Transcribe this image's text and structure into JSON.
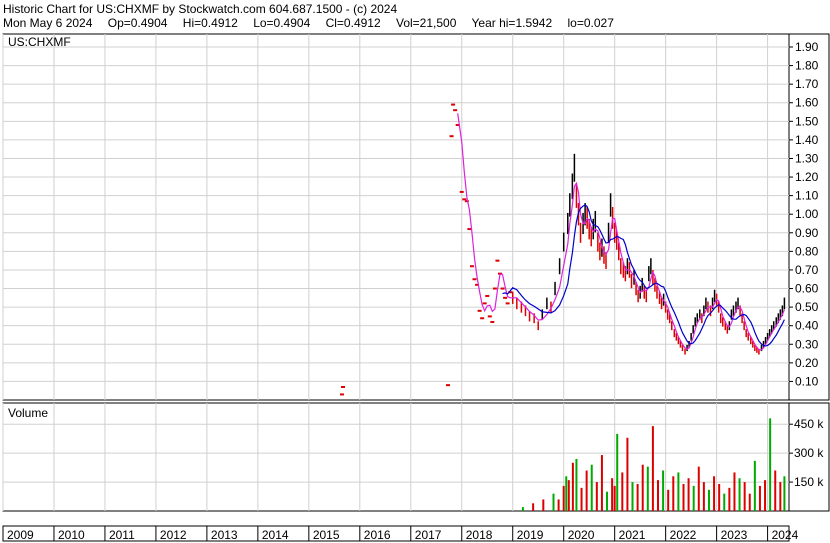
{
  "header": {
    "title": "Historic Chart for US:CHXMF by Stockwatch.com 604.687.1500 - (c) 2024",
    "date": "Mon May  6 2024",
    "open": "Op=0.4904",
    "high": "Hi=0.4912",
    "low": "Lo=0.4904",
    "close": "Cl=0.4912",
    "volume": "Vol=21,500",
    "year_high": "Year hi=1.5942",
    "year_low": "lo=0.027"
  },
  "chart_data": [
    {
      "type": "line",
      "title": "US:CHXMF",
      "price_ticks": [
        "1.90",
        "1.80",
        "1.70",
        "1.60",
        "1.50",
        "1.40",
        "1.30",
        "1.20",
        "1.10",
        "1.00",
        "0.90",
        "0.80",
        "0.70",
        "0.60",
        "0.50",
        "0.40",
        "0.30",
        "0.20",
        "0.10"
      ],
      "ylim": [
        0.0,
        1.97
      ],
      "xlim": [
        2009.0,
        2024.42
      ],
      "grid": true,
      "colors": {
        "bars": "#000000",
        "down": "#dd0000",
        "ma_short": "#dd22dd",
        "ma_long": "#0000cc",
        "grid": "#d0d0d0"
      },
      "series": [
        {
          "values_x": [
            2015.65,
            2015.67,
            2017.73,
            2017.8,
            2017.83,
            2017.87,
            2017.92,
            2018.0,
            2018.05,
            2018.1,
            2018.15,
            2018.2,
            2018.25,
            2018.3,
            2018.35,
            2018.4,
            2018.45,
            2018.5,
            2018.55,
            2018.6,
            2018.65,
            2018.7,
            2018.75,
            2018.8,
            2018.85,
            2018.9,
            2018.95,
            2019.0,
            2019.08,
            2019.17,
            2019.25,
            2019.33,
            2019.42,
            2019.5,
            2019.58,
            2019.67,
            2019.75,
            2019.83,
            2019.92,
            2020.0,
            2020.08,
            2020.12,
            2020.17,
            2020.21,
            2020.25,
            2020.29,
            2020.33,
            2020.38,
            2020.42,
            2020.46,
            2020.5,
            2020.54,
            2020.58,
            2020.62,
            2020.67,
            2020.71,
            2020.75,
            2020.79,
            2020.83,
            2020.88,
            2020.92,
            2020.96,
            2021.0,
            2021.04,
            2021.08,
            2021.12,
            2021.17,
            2021.21,
            2021.25,
            2021.29,
            2021.33,
            2021.38,
            2021.42,
            2021.46,
            2021.5,
            2021.54,
            2021.58,
            2021.62,
            2021.67,
            2021.71,
            2021.75,
            2021.79,
            2021.83,
            2021.88,
            2021.92,
            2021.96,
            2022.0,
            2022.04,
            2022.08,
            2022.12,
            2022.17,
            2022.21,
            2022.25,
            2022.29,
            2022.33,
            2022.38,
            2022.42,
            2022.46,
            2022.5,
            2022.54,
            2022.58,
            2022.62,
            2022.67,
            2022.71,
            2022.75,
            2022.79,
            2022.83,
            2022.88,
            2022.92,
            2022.96,
            2023.0,
            2023.04,
            2023.08,
            2023.12,
            2023.17,
            2023.21,
            2023.25,
            2023.29,
            2023.33,
            2023.38,
            2023.42,
            2023.46,
            2023.5,
            2023.54,
            2023.58,
            2023.62,
            2023.67,
            2023.71,
            2023.75,
            2023.79,
            2023.83,
            2023.88,
            2023.92,
            2023.96,
            2024.0,
            2024.04,
            2024.08,
            2024.12,
            2024.17,
            2024.21,
            2024.25,
            2024.29,
            2024.33
          ],
          "values_y": [
            0.03,
            0.07,
            0.08,
            1.42,
            1.59,
            1.56,
            1.48,
            1.12,
            1.08,
            1.07,
            0.92,
            0.72,
            0.65,
            0.62,
            0.48,
            0.44,
            0.52,
            0.56,
            0.45,
            0.42,
            0.6,
            0.75,
            0.68,
            0.6,
            0.55,
            0.52,
            0.58,
            0.55,
            0.52,
            0.5,
            0.48,
            0.45,
            0.44,
            0.4,
            0.46,
            0.52,
            0.5,
            0.6,
            0.72,
            0.85,
            0.95,
            1.05,
            1.15,
            1.25,
            1.1,
            1.0,
            0.9,
            0.95,
            1.0,
            0.98,
            0.92,
            0.88,
            0.92,
            0.96,
            0.85,
            0.8,
            0.82,
            0.78,
            0.75,
            0.9,
            1.05,
            0.98,
            0.9,
            0.86,
            0.8,
            0.72,
            0.7,
            0.68,
            0.72,
            0.7,
            0.64,
            0.66,
            0.6,
            0.56,
            0.58,
            0.62,
            0.58,
            0.56,
            0.68,
            0.72,
            0.66,
            0.62,
            0.58,
            0.55,
            0.52,
            0.54,
            0.5,
            0.46,
            0.44,
            0.4,
            0.36,
            0.34,
            0.32,
            0.3,
            0.28,
            0.26,
            0.28,
            0.3,
            0.34,
            0.38,
            0.42,
            0.44,
            0.46,
            0.44,
            0.48,
            0.52,
            0.5,
            0.48,
            0.52,
            0.56,
            0.54,
            0.5,
            0.44,
            0.42,
            0.4,
            0.38,
            0.4,
            0.46,
            0.48,
            0.5,
            0.52,
            0.48,
            0.44,
            0.4,
            0.36,
            0.34,
            0.32,
            0.3,
            0.28,
            0.27,
            0.26,
            0.28,
            0.3,
            0.32,
            0.34,
            0.36,
            0.38,
            0.4,
            0.42,
            0.44,
            0.46,
            0.48,
            0.52,
            0.5,
            0.49
          ]
        }
      ]
    },
    {
      "type": "bar",
      "title": "Volume",
      "volume_ticks": [
        "450 k",
        "300 k",
        "150 k"
      ],
      "ylim": [
        0,
        560
      ],
      "x_tick_labels": [
        "2009",
        "2010",
        "2011",
        "2012",
        "2013",
        "2014",
        "2015",
        "2016",
        "2017",
        "2018",
        "2019",
        "2020",
        "2021",
        "2022",
        "2023",
        "2024"
      ],
      "x_ticks": [
        2009,
        2010,
        2011,
        2012,
        2013,
        2014,
        2015,
        2016,
        2017,
        2018,
        2019,
        2020,
        2021,
        2022,
        2023,
        2024
      ],
      "colors": {
        "up": "#00aa00",
        "down": "#dd0000"
      },
      "series": [
        {
          "values_x": [
            2019.2,
            2019.4,
            2019.6,
            2019.8,
            2019.9,
            2020.0,
            2020.05,
            2020.1,
            2020.18,
            2020.25,
            2020.35,
            2020.45,
            2020.55,
            2020.65,
            2020.75,
            2020.85,
            2020.95,
            2021.0,
            2021.05,
            2021.15,
            2021.25,
            2021.35,
            2021.45,
            2021.55,
            2021.65,
            2021.75,
            2021.85,
            2021.95,
            2022.05,
            2022.15,
            2022.25,
            2022.35,
            2022.45,
            2022.55,
            2022.65,
            2022.75,
            2022.85,
            2022.95,
            2023.05,
            2023.15,
            2023.25,
            2023.35,
            2023.45,
            2023.55,
            2023.65,
            2023.75,
            2023.85,
            2023.95,
            2024.05,
            2024.15,
            2024.25,
            2024.33
          ],
          "values_y": [
            20,
            40,
            60,
            90,
            60,
            130,
            180,
            160,
            250,
            270,
            120,
            210,
            240,
            150,
            290,
            100,
            170,
            130,
            400,
            200,
            380,
            150,
            140,
            240,
            230,
            440,
            160,
            210,
            110,
            180,
            200,
            140,
            170,
            130,
            230,
            150,
            110,
            180,
            140,
            90,
            120,
            200,
            170,
            150,
            90,
            260,
            130,
            160,
            480,
            210,
            150,
            180
          ]
        }
      ]
    }
  ]
}
